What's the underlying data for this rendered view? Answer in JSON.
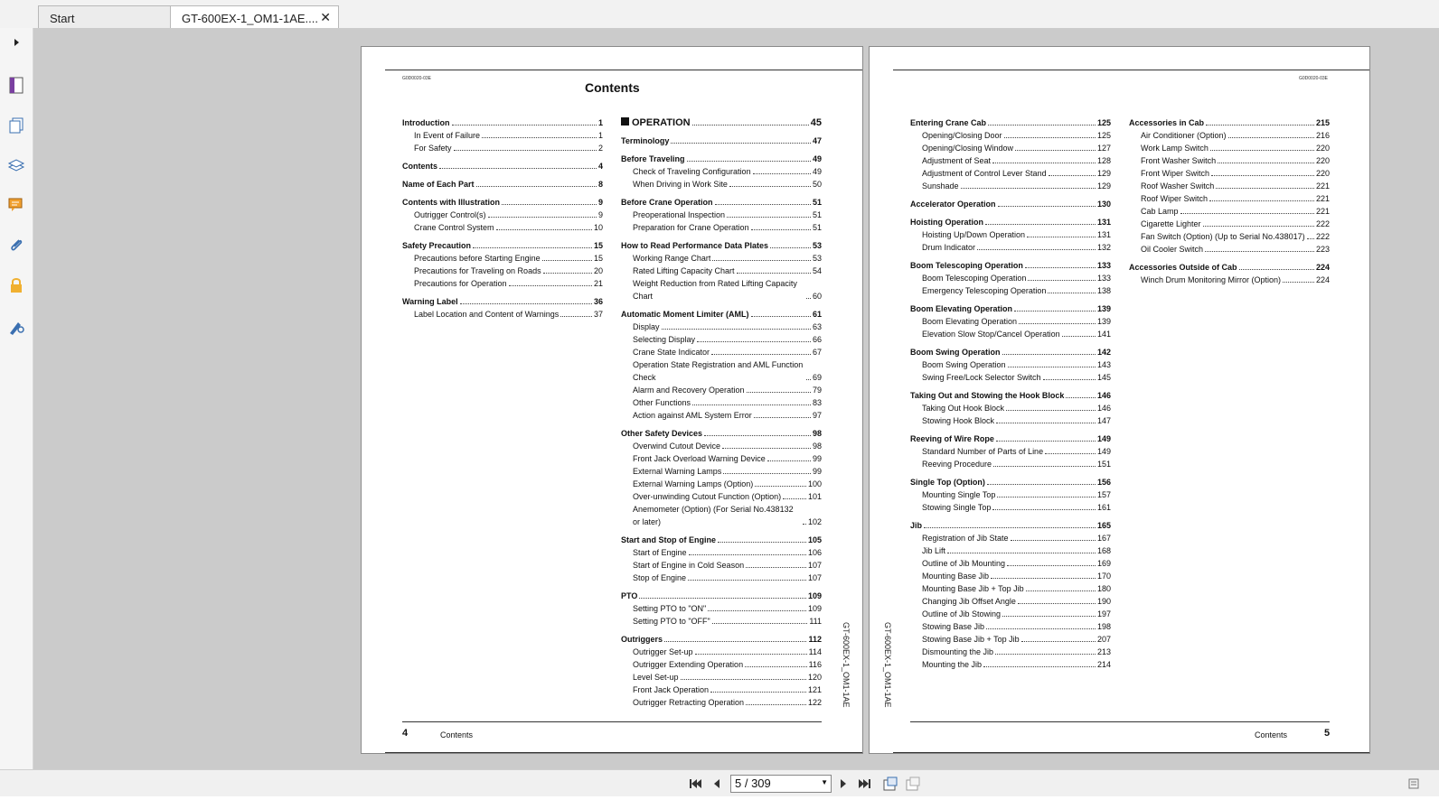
{
  "tabs": [
    {
      "label": "Start"
    },
    {
      "label": "GT-600EX-1_OM1-1AE...."
    }
  ],
  "sidebar_icons": [
    "expand-arrow-icon",
    "page-icon",
    "thumbnails-icon",
    "layers-icon",
    "comments-icon",
    "attachments-icon",
    "lock-icon",
    "signature-icon"
  ],
  "navigation": {
    "page_display": "5 / 309"
  },
  "left_page": {
    "code": "G0D0020-03E",
    "title": "Contents",
    "footer_num": "4",
    "footer_label": "Contents",
    "side_text": "GT-600EX-1_OM1-1AE",
    "col1": [
      {
        "title": "Introduction",
        "page": "1",
        "items": [
          {
            "title": "In Event of Failure",
            "page": "1"
          },
          {
            "title": "For Safety",
            "page": "2"
          }
        ]
      },
      {
        "title": "Contents",
        "page": "4",
        "items": []
      },
      {
        "title": "Name of Each Part",
        "page": "8",
        "items": []
      },
      {
        "title": "Contents with Illustration",
        "page": "9",
        "items": [
          {
            "title": "Outrigger Control(s)",
            "page": "9"
          },
          {
            "title": "Crane Control System",
            "page": "10"
          }
        ]
      },
      {
        "title": "Safety Precaution",
        "page": "15",
        "items": [
          {
            "title": "Precautions before Starting Engine",
            "page": "15"
          },
          {
            "title": "Precautions for Traveling on Roads",
            "page": "20"
          },
          {
            "title": "Precautions for Operation",
            "page": "21"
          }
        ]
      },
      {
        "title": "Warning Label",
        "page": "36",
        "items": [
          {
            "title": "Label Location and Content of Warnings",
            "page": "37"
          }
        ]
      }
    ],
    "operation_header": {
      "title": "OPERATION",
      "page": "45"
    },
    "col2": [
      {
        "title": "Terminology",
        "page": "47",
        "items": []
      },
      {
        "title": "Before Traveling",
        "page": "49",
        "items": [
          {
            "title": "Check of Traveling Configuration",
            "page": "49"
          },
          {
            "title": "When Driving in Work Site",
            "page": "50"
          }
        ]
      },
      {
        "title": "Before Crane Operation",
        "page": "51",
        "items": [
          {
            "title": "Preoperational Inspection",
            "page": "51"
          },
          {
            "title": "Preparation for Crane Operation",
            "page": "51"
          }
        ]
      },
      {
        "title": "How to Read Performance Data Plates",
        "page": "53",
        "items": [
          {
            "title": "Working Range Chart",
            "page": "53"
          },
          {
            "title": "Rated Lifting Capacity Chart",
            "page": "54"
          },
          {
            "title": "Weight Reduction from Rated Lifting Capacity Chart",
            "page": "60"
          }
        ]
      },
      {
        "title": "Automatic Moment Limiter (AML)",
        "page": "61",
        "items": [
          {
            "title": "Display",
            "page": "63"
          },
          {
            "title": "Selecting Display",
            "page": "66"
          },
          {
            "title": "Crane State Indicator",
            "page": "67"
          },
          {
            "title": "Operation State Registration and AML Function Check",
            "page": "69"
          },
          {
            "title": "Alarm and Recovery Operation",
            "page": "79"
          },
          {
            "title": "Other Functions",
            "page": "83"
          },
          {
            "title": "Action against AML System Error",
            "page": "97"
          }
        ]
      },
      {
        "title": "Other Safety Devices",
        "page": "98",
        "items": [
          {
            "title": "Overwind Cutout Device",
            "page": "98"
          },
          {
            "title": "Front Jack Overload Warning Device",
            "page": "99"
          },
          {
            "title": "External Warning Lamps",
            "page": "99"
          },
          {
            "title": "External Warning Lamps (Option)",
            "page": "100"
          },
          {
            "title": "Over-unwinding Cutout Function (Option)",
            "page": "101"
          },
          {
            "title": "Anemometer (Option) (For Serial No.438132 or later)",
            "page": "102"
          }
        ]
      },
      {
        "title": "Start and Stop of Engine",
        "page": "105",
        "items": [
          {
            "title": "Start of Engine",
            "page": "106"
          },
          {
            "title": "Start of Engine in Cold Season",
            "page": "107"
          },
          {
            "title": "Stop of Engine",
            "page": "107"
          }
        ]
      },
      {
        "title": "PTO",
        "page": "109",
        "items": [
          {
            "title": "Setting PTO to \"ON\"",
            "page": "109"
          },
          {
            "title": "Setting PTO to \"OFF\"",
            "page": "111"
          }
        ]
      },
      {
        "title": "Outriggers",
        "page": "112",
        "items": [
          {
            "title": "Outrigger Set-up",
            "page": "114"
          },
          {
            "title": "Outrigger Extending Operation",
            "page": "116"
          },
          {
            "title": "Level Set-up",
            "page": "120"
          },
          {
            "title": "Front Jack Operation",
            "page": "121"
          },
          {
            "title": "Outrigger Retracting Operation",
            "page": "122"
          }
        ]
      }
    ]
  },
  "right_page": {
    "code": "G0D0020-03E",
    "footer_num": "5",
    "footer_label": "Contents",
    "side_text": "GT-600EX-1_OM1-1AE",
    "col1": [
      {
        "title": "Entering Crane Cab",
        "page": "125",
        "items": [
          {
            "title": "Opening/Closing Door",
            "page": "125"
          },
          {
            "title": "Opening/Closing Window",
            "page": "127"
          },
          {
            "title": "Adjustment of Seat",
            "page": "128"
          },
          {
            "title": "Adjustment of Control Lever Stand",
            "page": "129"
          },
          {
            "title": "Sunshade",
            "page": "129"
          }
        ]
      },
      {
        "title": "Accelerator Operation",
        "page": "130",
        "items": []
      },
      {
        "title": "Hoisting Operation",
        "page": "131",
        "items": [
          {
            "title": "Hoisting Up/Down Operation",
            "page": "131"
          },
          {
            "title": "Drum Indicator",
            "page": "132"
          }
        ]
      },
      {
        "title": "Boom Telescoping Operation",
        "page": "133",
        "items": [
          {
            "title": "Boom Telescoping Operation",
            "page": "133"
          },
          {
            "title": "Emergency Telescoping Operation",
            "page": "138"
          }
        ]
      },
      {
        "title": "Boom Elevating Operation",
        "page": "139",
        "items": [
          {
            "title": "Boom Elevating Operation",
            "page": "139"
          },
          {
            "title": "Elevation Slow Stop/Cancel Operation",
            "page": "141"
          }
        ]
      },
      {
        "title": "Boom Swing Operation",
        "page": "142",
        "items": [
          {
            "title": "Boom Swing Operation",
            "page": "143"
          },
          {
            "title": "Swing Free/Lock Selector Switch",
            "page": "145"
          }
        ]
      },
      {
        "title": "Taking Out and Stowing the Hook Block",
        "page": "146",
        "items": [
          {
            "title": "Taking Out Hook Block",
            "page": "146"
          },
          {
            "title": "Stowing Hook Block",
            "page": "147"
          }
        ]
      },
      {
        "title": "Reeving of Wire Rope",
        "page": "149",
        "items": [
          {
            "title": "Standard Number of Parts of Line",
            "page": "149"
          },
          {
            "title": "Reeving Procedure",
            "page": "151"
          }
        ]
      },
      {
        "title": "Single Top (Option)",
        "page": "156",
        "items": [
          {
            "title": "Mounting Single Top",
            "page": "157"
          },
          {
            "title": "Stowing Single Top",
            "page": "161"
          }
        ]
      },
      {
        "title": "Jib",
        "page": "165",
        "items": [
          {
            "title": "Registration of Jib State",
            "page": "167"
          },
          {
            "title": "Jib Lift",
            "page": "168"
          },
          {
            "title": "Outline of Jib Mounting",
            "page": "169"
          },
          {
            "title": "Mounting Base Jib",
            "page": "170"
          },
          {
            "title": "Mounting Base Jib + Top Jib",
            "page": "180"
          },
          {
            "title": "Changing Jib Offset Angle",
            "page": "190"
          },
          {
            "title": "Outline of Jib Stowing",
            "page": "197"
          },
          {
            "title": "Stowing Base Jib",
            "page": "198"
          },
          {
            "title": "Stowing Base Jib + Top Jib",
            "page": "207"
          },
          {
            "title": "Dismounting the Jib",
            "page": "213"
          },
          {
            "title": "Mounting the Jib",
            "page": "214"
          }
        ]
      }
    ],
    "col2": [
      {
        "title": "Accessories in Cab",
        "page": "215",
        "items": [
          {
            "title": "Air Conditioner (Option)",
            "page": "216"
          },
          {
            "title": "Work Lamp Switch",
            "page": "220"
          },
          {
            "title": "Front Washer Switch",
            "page": "220"
          },
          {
            "title": "Front Wiper Switch",
            "page": "220"
          },
          {
            "title": "Roof Washer Switch",
            "page": "221"
          },
          {
            "title": "Roof Wiper Switch",
            "page": "221"
          },
          {
            "title": "Cab Lamp",
            "page": "221"
          },
          {
            "title": "Cigarette Lighter",
            "page": "222"
          },
          {
            "title": "Fan Switch (Option) (Up to Serial No.438017)",
            "page": "222"
          },
          {
            "title": "Oil Cooler Switch",
            "page": "223"
          }
        ]
      },
      {
        "title": "Accessories Outside of Cab",
        "page": "224",
        "items": [
          {
            "title": "Winch Drum Monitoring Mirror (Option)",
            "page": "224"
          }
        ]
      }
    ]
  }
}
